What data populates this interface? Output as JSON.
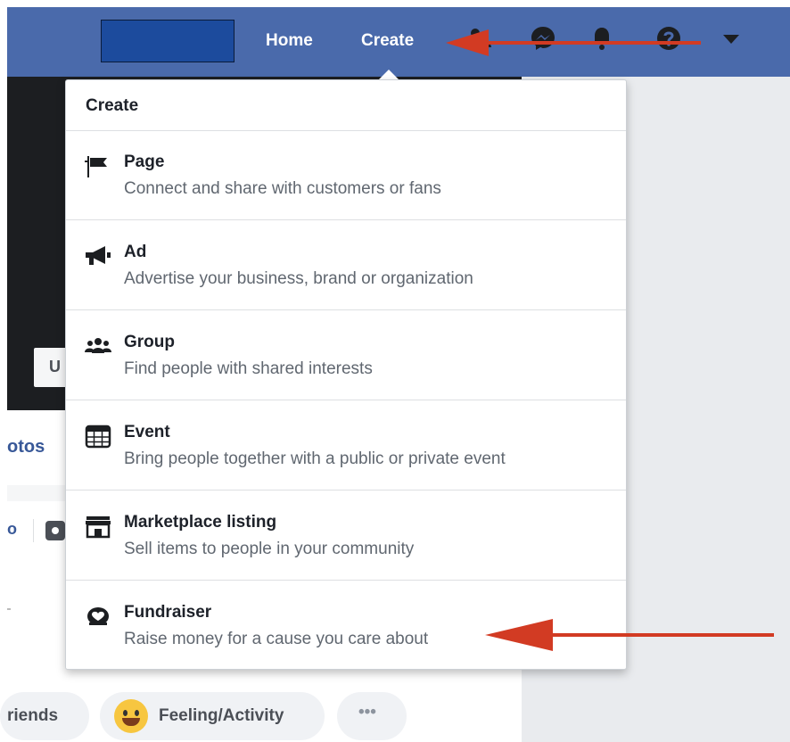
{
  "topbar": {
    "nav": [
      {
        "label": "Home"
      },
      {
        "label": "Create"
      }
    ],
    "icons": [
      "friends-icon",
      "messenger-icon",
      "notifications-bell-icon",
      "help-icon",
      "account-caret-icon"
    ],
    "color": "#4a6aab"
  },
  "background": {
    "cover_button_partial": "U",
    "tab_partial": "otos",
    "fragment_o": "o",
    "pills": [
      {
        "label": "riends"
      },
      {
        "label": "Feeling/Activity"
      },
      {
        "label": "•••"
      }
    ]
  },
  "menu": {
    "header": "Create",
    "items": [
      {
        "icon": "flag-icon",
        "title": "Page",
        "description": "Connect and share with customers or fans"
      },
      {
        "icon": "megaphone-icon",
        "title": "Ad",
        "description": "Advertise your business, brand or organization"
      },
      {
        "icon": "group-icon",
        "title": "Group",
        "description": "Find people with shared interests"
      },
      {
        "icon": "calendar-icon",
        "title": "Event",
        "description": "Bring people together with a public or private event"
      },
      {
        "icon": "storefront-icon",
        "title": "Marketplace listing",
        "description": "Sell items to people in your community"
      },
      {
        "icon": "fundraiser-icon",
        "title": "Fundraiser",
        "description": "Raise money for a cause you care about"
      }
    ]
  },
  "annotations": {
    "arrow_color": "#d23b23"
  }
}
